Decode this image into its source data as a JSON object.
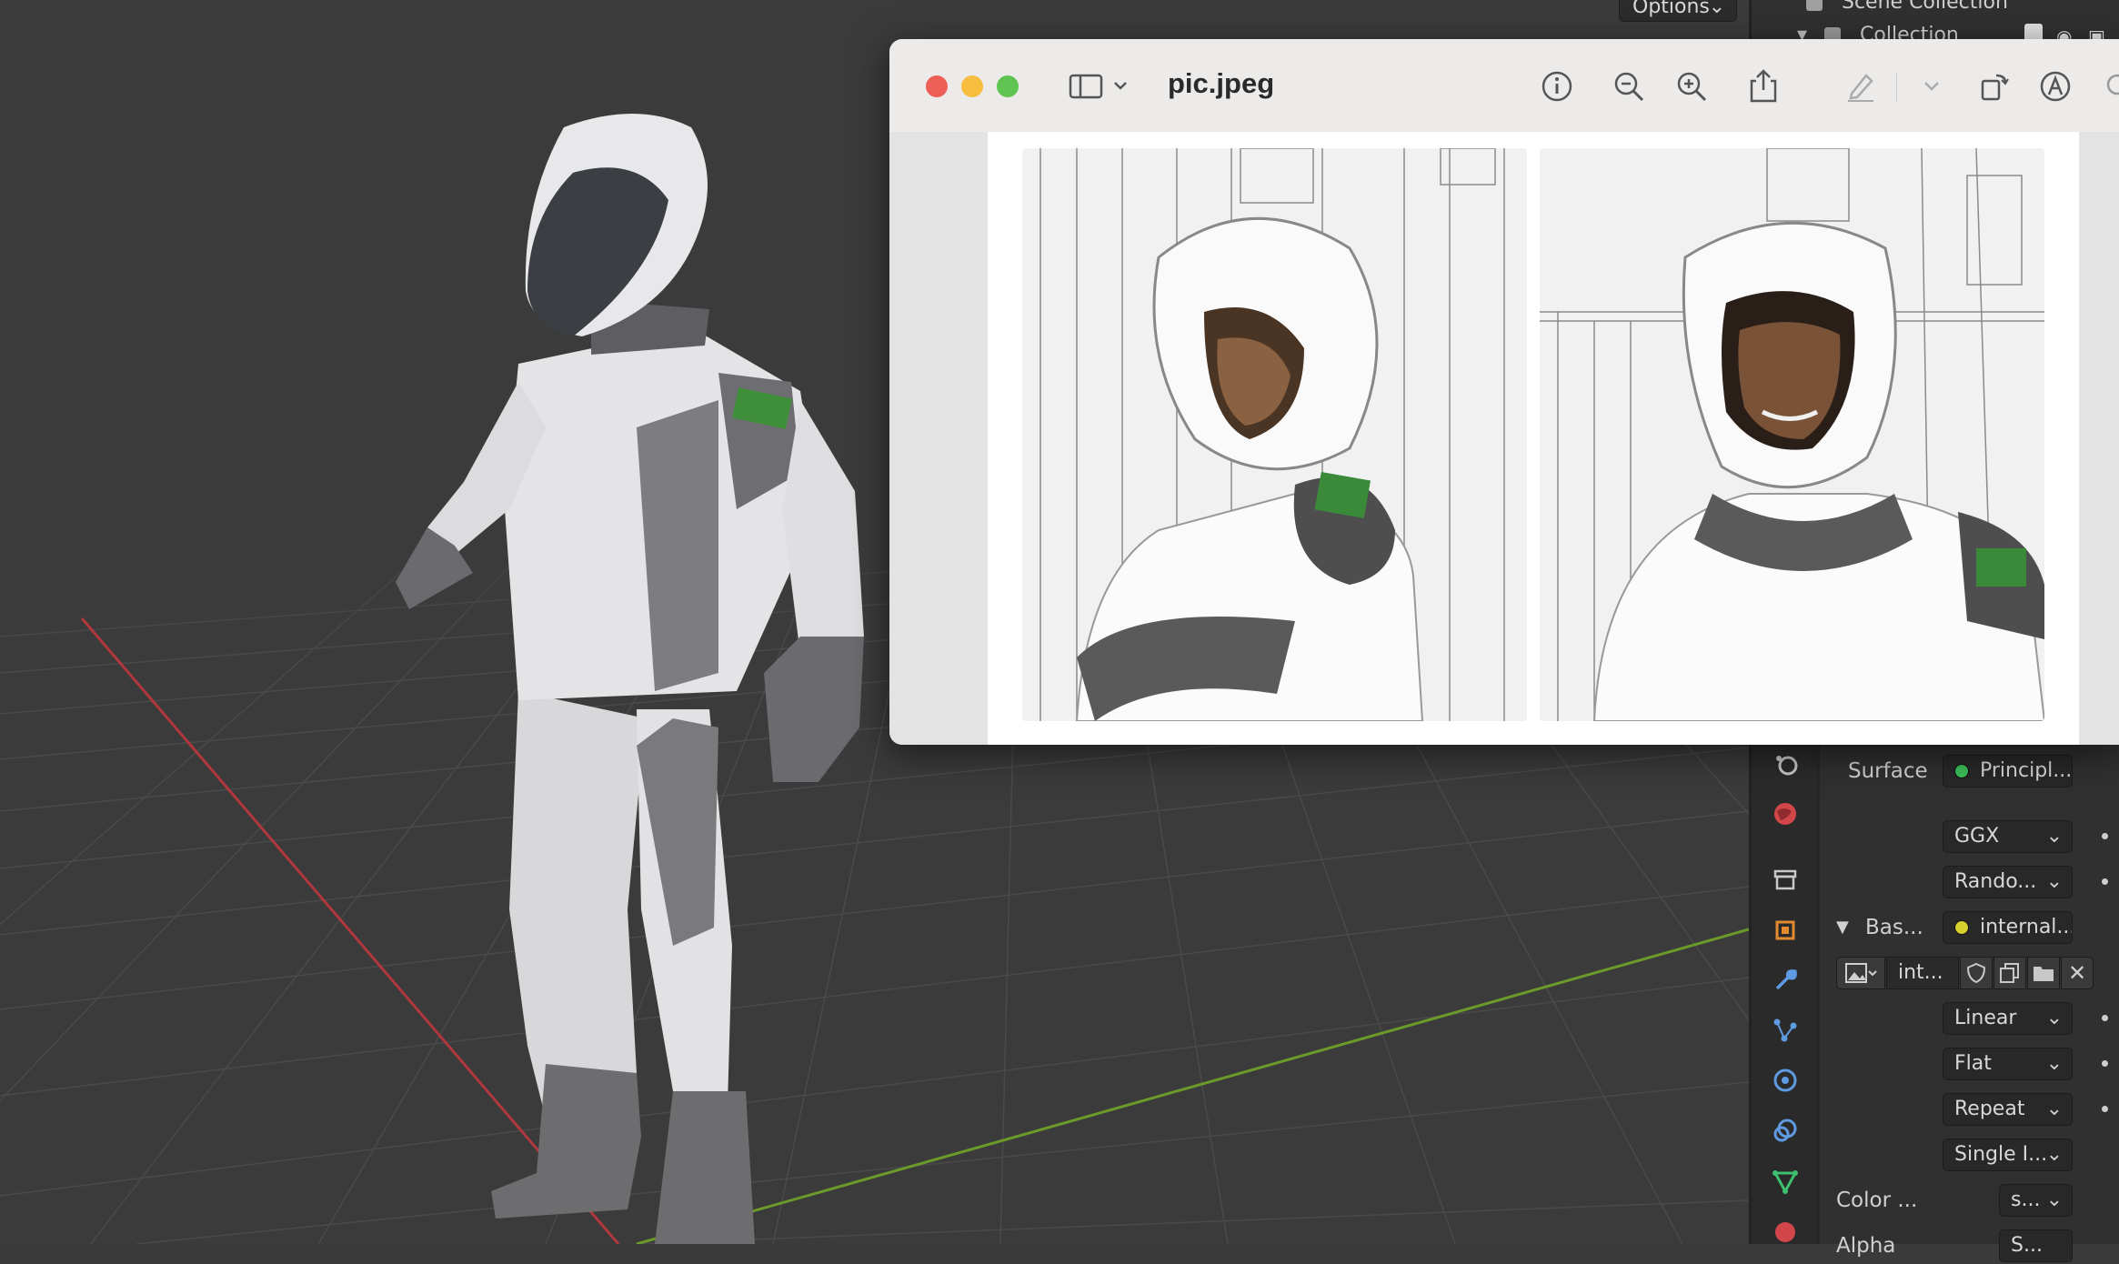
{
  "viewport": {
    "options_label": "Options",
    "chevron_icon": "chevron-down-icon"
  },
  "outliner": {
    "scene_collection": "Scene Collection",
    "collection": "Collection"
  },
  "preview": {
    "title": "pic.jpeg",
    "icons": [
      "sidebar-icon",
      "info-icon",
      "zoom-out-icon",
      "zoom-in-icon",
      "share-icon",
      "markup-pen-icon",
      "rotate-icon",
      "annotate-icon",
      "search-icon"
    ]
  },
  "properties": {
    "surface_label": "Surface",
    "surface_value": "Principl...",
    "distribution": "GGX",
    "subsurface": "Rando...",
    "base_color_label": "Bas...",
    "base_color_value": "internal...",
    "image_name": "int...",
    "interpolation": "Linear",
    "projection": "Flat",
    "extension": "Repeat",
    "source": "Single I...",
    "color_label": "Color ...",
    "color_value": "s...",
    "alpha_label": "Alpha",
    "alpha_value": "S..."
  },
  "colors": {
    "close": "#ee5f58",
    "minimize": "#f6bd3e",
    "maximize": "#5fc451",
    "surface_socket": "#3fbf5b",
    "color_socket": "#d6d02f",
    "x_axis": "#b0383d",
    "y_axis": "#6c9a2a"
  }
}
